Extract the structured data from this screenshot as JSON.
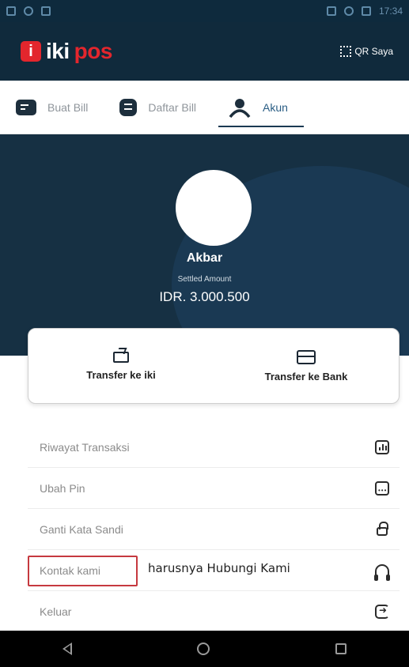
{
  "statusbar": {
    "time": "17:34"
  },
  "appbar": {
    "logo_iki": "iki",
    "logo_pos": "pos",
    "logo_mark": "i",
    "qr_label": "QR Saya"
  },
  "tabs": [
    {
      "label": "Buat Bill",
      "icon": "bill-icon"
    },
    {
      "label": "Daftar Bill",
      "icon": "list-icon"
    },
    {
      "label": "Akun",
      "icon": "user-icon",
      "active": true
    }
  ],
  "profile": {
    "name": "Akbar",
    "settled_label": "Settled Amount",
    "amount": "IDR. 3.000.500"
  },
  "actions": [
    {
      "label": "Transfer ke iki",
      "icon": "wallet-icon"
    },
    {
      "label": "Transfer ke Bank",
      "icon": "card-icon"
    }
  ],
  "menu": [
    {
      "label": "Riwayat Transaksi",
      "icon": "chart-icon"
    },
    {
      "label": "Ubah Pin",
      "icon": "pin-icon"
    },
    {
      "label": "Ganti Kata Sandi",
      "icon": "lock-icon"
    },
    {
      "label": "Kontak kami",
      "icon": "headset-icon"
    },
    {
      "label": "Keluar",
      "icon": "logout-icon"
    }
  ],
  "annotation": "harusnya Hubungi Kami",
  "colors": {
    "header": "#102a3c",
    "brand_red": "#e3262d",
    "highlight": "#c6393f"
  }
}
